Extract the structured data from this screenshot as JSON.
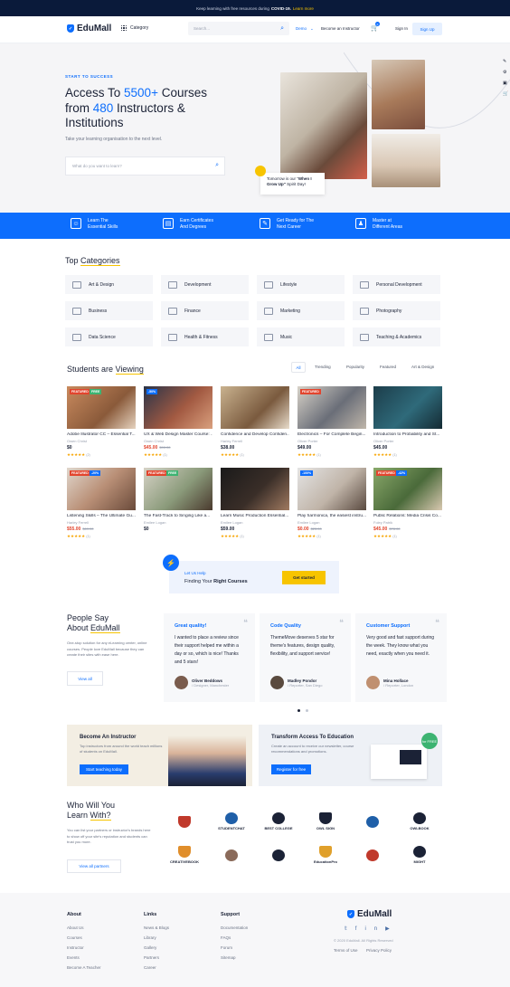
{
  "topbar": {
    "text": "Keep learning with free resources during",
    "bold": "COVID-19.",
    "link": "Learn more"
  },
  "header": {
    "logo": "EduMall",
    "category": "Category",
    "search_placeholder": "Search...",
    "nav": [
      "Demo",
      "Become an Instructor"
    ],
    "cart_count": "0",
    "signin": "Sign In",
    "signup": "Sign Up"
  },
  "hero": {
    "kicker": "START TO SUCCESS",
    "line1a": "Access To ",
    "line1b": "5500+",
    "line1c": " Courses",
    "line2a": "from ",
    "line2b": "480",
    "line2c": " Instructors &",
    "line3": "Institutions",
    "subtitle": "Take your learning organisation to the next level.",
    "search_placeholder": "What do you want to learn?",
    "note_a": "Tomorrow is our \"",
    "note_b": "When I Grow Up\"",
    "note_c": " Spirit Day!"
  },
  "benefits": [
    {
      "l1": "Learn The",
      "l2": "Essential Skills"
    },
    {
      "l1": "Earn Certificates",
      "l2": "And Degrees"
    },
    {
      "l1": "Get Ready for The",
      "l2": "Next Career"
    },
    {
      "l1": "Master at",
      "l2": "Different Areas"
    }
  ],
  "categories": {
    "title_a": "Top ",
    "title_b": "Categories",
    "items": [
      "Art & Design",
      "Development",
      "Lifestyle",
      "Personal Development",
      "Business",
      "Finance",
      "Marketing",
      "Photography",
      "Data Science",
      "Health & Fitness",
      "Music",
      "Teaching & Academics"
    ]
  },
  "students": {
    "title_a": "Students are ",
    "title_b": "Viewing",
    "tabs": [
      "All",
      "Trending",
      "Popularity",
      "Featured",
      "Art & Design"
    ],
    "courses": [
      {
        "title": "Adobe Illustrator CC – Essential T...",
        "author": "Owen Christ",
        "price": "$0",
        "old": "",
        "rating": "(2)",
        "tags": [
          "FEATURED",
          "FREE"
        ]
      },
      {
        "title": "UX & Web Design Master Course: ...",
        "author": "Owen Christ",
        "price": "$45.00",
        "old": "$90.00",
        "rating": "(1)",
        "tags": [
          "-50%"
        ]
      },
      {
        "title": "Confidence and Develop Confiden...",
        "author": "Harley Ferrell",
        "price": "$38.00",
        "old": "",
        "rating": "(1)",
        "tags": []
      },
      {
        "title": "Electronics – For Complete Begin...",
        "author": "Oliver Porter",
        "price": "$49.00",
        "old": "",
        "rating": "(1)",
        "tags": [
          "FEATURED"
        ]
      },
      {
        "title": "Introduction to Probability and St...",
        "author": "Oliver Porter",
        "price": "$45.00",
        "old": "",
        "rating": "(1)",
        "tags": []
      },
      {
        "title": "Listening Skills – The Ultimate Gu...",
        "author": "Harley Ferrell",
        "price": "$55.00",
        "old": "$69.00",
        "rating": "(1)",
        "tags": [
          "FEATURED",
          "-20%"
        ]
      },
      {
        "title": "The Fast-Track to Singing Like a...",
        "author": "Emilee Logan",
        "price": "$0",
        "old": "",
        "rating": "",
        "tags": [
          "FEATURED",
          "FREE"
        ]
      },
      {
        "title": "Learn Music Production Essential...",
        "author": "Emilee Logan",
        "price": "$59.00",
        "old": "",
        "rating": "(1)",
        "tags": []
      },
      {
        "title": "Play harmonica, the easiest instru...",
        "author": "Emilee Logan",
        "price": "$0.00",
        "old": "$25.00",
        "rating": "(1)",
        "tags": [
          "-100%"
        ]
      },
      {
        "title": "Public Relations: Media Crisis Co...",
        "author": "Foley Patrik",
        "price": "$45.00",
        "old": "$78.00",
        "rating": "(1)",
        "tags": [
          "FEATURED",
          "-42%"
        ]
      }
    ]
  },
  "lethelp": {
    "small": "Let Us Help",
    "big_a": "Finding Your ",
    "big_b": "Right Courses",
    "button": "Get started"
  },
  "testimonials": {
    "title1": "People Say",
    "title2": "About ",
    "title3": "EduMall",
    "desc": "One-stop solution for any eLearning center, online courses. People love EduMall because they can create their sites with ease here.",
    "view_all": "View all",
    "items": [
      {
        "title": "Great quality!",
        "quote": "I wanted to place a review since their support helped me within a day or so, which is nice! Thanks and 5 stars!",
        "name": "Oliver Beddows",
        "role": "/ Designer, Manchester"
      },
      {
        "title": "Code Quality",
        "quote": "ThemeMove deserves 5 star for theme's features, design quality, flexibility, and support service!",
        "name": "Madley Pondor",
        "role": "/ Reporter, San Diego"
      },
      {
        "title": "Customer Support",
        "quote": "Very good and fast support during the week. They know what you need, exactly when you need it.",
        "name": "Mina Hollace",
        "role": "/ Reporter, London"
      }
    ]
  },
  "promo": {
    "inst_title": "Become An Instructor",
    "inst_desc": "Top instructors from around the world teach millions of students on EduMall.",
    "inst_btn": "Start teaching today",
    "biz_title": "Transform Access To Education",
    "biz_desc": "Create an account to receive our newsletter, course recommendations and promotions.",
    "biz_btn": "Register for free",
    "badge": "for FREE"
  },
  "partners": {
    "title1": "Who Will You",
    "title2": "Learn ",
    "title3": "With?",
    "desc": "You can list your partners or instructor's brands here to show off your site's reputation and students can trust you more.",
    "button": "View all partners",
    "logos": [
      "",
      "STUDENTCHAT",
      "BEST COLLEGE",
      "OWL SIGN",
      "",
      "OWLBOOK",
      "CREATIVEBOOK",
      "",
      "",
      "EducationPro",
      "",
      "MIGHT"
    ]
  },
  "footer": {
    "about": {
      "title": "About",
      "items": [
        "About Us",
        "Courses",
        "Instructor",
        "Events",
        "Become A Teacher"
      ]
    },
    "links": {
      "title": "Links",
      "items": [
        "News & Blogs",
        "Library",
        "Gallery",
        "Partners",
        "Career"
      ]
    },
    "support": {
      "title": "Support",
      "items": [
        "Documentation",
        "FAQs",
        "Forum",
        "Sitemap"
      ]
    },
    "logo": "EduMall",
    "copyright": "© 2020 EduMall. All Rights Reserved",
    "terms": "Terms of Use",
    "privacy": "Privacy Policy"
  },
  "colors": {
    "primary": "#0d6efd",
    "accent": "#f7c400",
    "dark": "#0a1a3a",
    "sale": "#e2452e"
  }
}
